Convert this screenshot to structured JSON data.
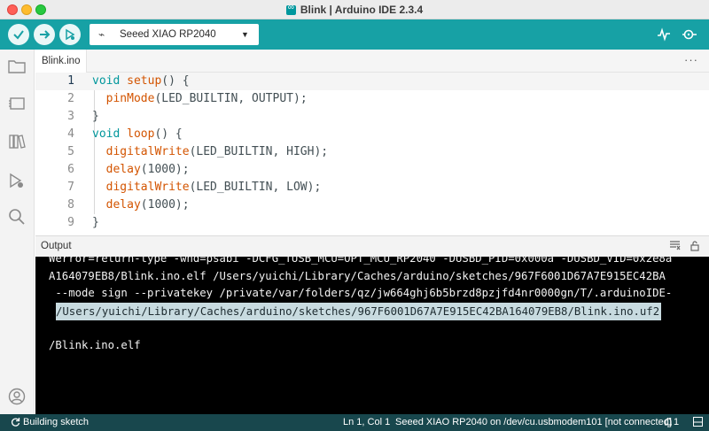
{
  "window": {
    "title": "Blink | Arduino IDE 2.3.4"
  },
  "toolbar": {
    "verify_icon": "check-icon",
    "upload_icon": "arrow-right-icon",
    "debug_icon": "debug-icon",
    "board_select": "Seeed XIAO RP2040",
    "plotter_icon": "serial-plotter-icon",
    "monitor_icon": "serial-monitor-icon",
    "accent": "#17a1a5"
  },
  "sidebar": {
    "items": [
      "folder-icon",
      "board-manager-icon",
      "library-manager-icon",
      "debug-icon",
      "search-icon",
      "account-icon"
    ]
  },
  "tabs": {
    "active": "Blink.ino",
    "more": "···"
  },
  "editor": {
    "lines": [
      {
        "n": "1",
        "kw": "void ",
        "fn": "setup",
        "rest": "() {"
      },
      {
        "n": "2",
        "fn": "  pinMode",
        "rest": "(LED_BUILTIN, OUTPUT);"
      },
      {
        "n": "3",
        "rest": "}"
      },
      {
        "n": "4",
        "kw": "void ",
        "fn": "loop",
        "rest": "() {"
      },
      {
        "n": "5",
        "fn": "  digitalWrite",
        "rest": "(LED_BUILTIN, HIGH);"
      },
      {
        "n": "6",
        "fn": "  delay",
        "rest": "(1000);"
      },
      {
        "n": "7",
        "fn": "  digitalWrite",
        "rest": "(LED_BUILTIN, LOW);"
      },
      {
        "n": "8",
        "fn": "  delay",
        "rest": "(1000);"
      },
      {
        "n": "9",
        "rest": "}"
      }
    ]
  },
  "output": {
    "title": "Output",
    "lines": [
      "Werror=return-type -whd=psabi -DCFG_TUSB_MCU=OPT_MCU_RP2040 -DUSBD_PID=0x000a -DUSBD_VID=0x2e8a",
      "A164079EB8/Blink.ino.elf /Users/yuichi/Library/Caches/arduino/sketches/967F6001D67A7E915EC42BA",
      " --mode sign --privatekey /private/var/folders/qz/jw664ghj6b5brzd8pzjfd4nr0000gn/T/.arduinoIDE-",
      "/Users/yuichi/Library/Caches/arduino/sketches/967F6001D67A7E915EC42BA164079EB8/Blink.ino.uf2",
      "/Blink.ino.elf"
    ]
  },
  "status": {
    "building": "Building sketch",
    "position": "Ln 1, Col 1",
    "board": "Seeed XIAO RP2040 on /dev/cu.usbmodem101 [not connected]",
    "notifications": "1"
  }
}
